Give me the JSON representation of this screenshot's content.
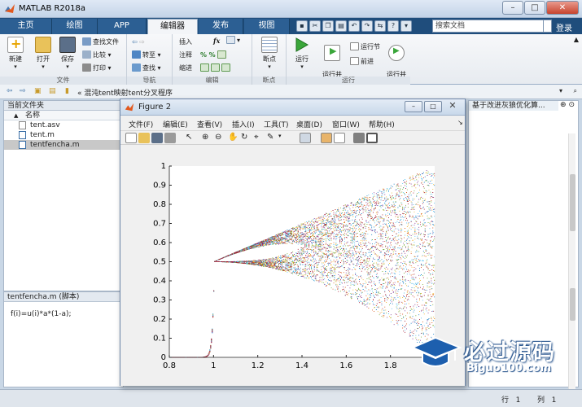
{
  "window": {
    "title": "MATLAB R2018a"
  },
  "tabs": [
    {
      "label": "主页"
    },
    {
      "label": "绘图"
    },
    {
      "label": "APP"
    },
    {
      "label": "编辑器"
    },
    {
      "label": "发布"
    },
    {
      "label": "视图"
    }
  ],
  "search": {
    "placeholder": "搜索文档"
  },
  "login_label": "登录",
  "ribbon": {
    "file": {
      "section": "文件",
      "new": "新建",
      "open": "打开",
      "save": "保存",
      "find_files": "查找文件",
      "compare": "比较",
      "print": "打印"
    },
    "navigate": {
      "section": "导航",
      "goto": "转至",
      "find": "查找"
    },
    "edit": {
      "section": "编辑",
      "insert": "插入",
      "fx": "fx",
      "comment": "注释",
      "indent": "缩进"
    },
    "breakpoints": {
      "section": "断点",
      "breakpoints": "断点"
    },
    "run": {
      "section": "运行",
      "run": "运行",
      "run_advance": "运行并\n前进",
      "run_section": "运行节",
      "advance": "前进",
      "run_time": "运行并\n计时"
    }
  },
  "address": {
    "path": "«  混沌tent映射tent分叉程序"
  },
  "current_folder": {
    "title": "当前文件夹",
    "column": "名称",
    "files": [
      {
        "name": "tent.asv"
      },
      {
        "name": "tent.m"
      },
      {
        "name": "tentfencha.m"
      }
    ]
  },
  "details": {
    "title": "tentfencha.m  (脚本)",
    "code": "f(i)=u(i)*a*(1-a);"
  },
  "editor": {
    "title": "基于改进灰狼优化算..."
  },
  "status": {
    "row_label": "行",
    "row_value": "1",
    "col_label": "列",
    "col_value": "1"
  },
  "figure": {
    "title": "Figure 2",
    "menu": [
      "文件(F)",
      "编辑(E)",
      "查看(V)",
      "插入(I)",
      "工具(T)",
      "桌面(D)",
      "窗口(W)",
      "帮助(H)"
    ]
  },
  "chart_data": {
    "type": "scatter",
    "title": "",
    "xlabel": "",
    "ylabel": "",
    "xlim": [
      0.8,
      2.0
    ],
    "ylim": [
      0,
      1
    ],
    "xticks": [
      0.8,
      1,
      1.2,
      1.4,
      1.6,
      1.8
    ],
    "yticks": [
      0,
      0.1,
      0.2,
      0.3,
      0.4,
      0.5,
      0.6,
      0.7,
      0.8,
      0.9,
      1
    ],
    "grid": false,
    "description_points": "tent map bifurcation: x_{n+1}=u*min(x,1-x), u from 0.8 to 2.0"
  },
  "watermark": {
    "text": "必过源码",
    "url": "Biguo100.com"
  },
  "colors": {
    "ribbon_tab_bg": "#1f4d7c",
    "accent": "#2c5f93"
  }
}
